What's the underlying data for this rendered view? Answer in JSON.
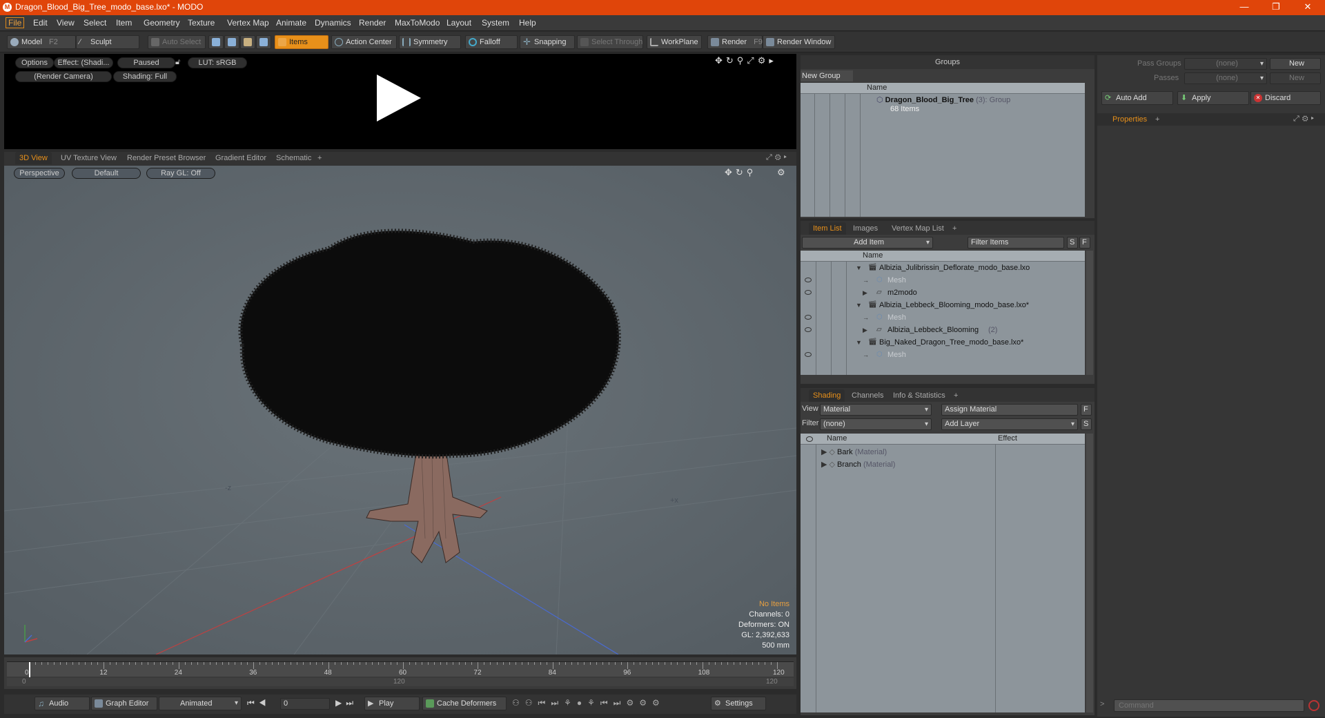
{
  "window": {
    "title": "Dragon_Blood_Big_Tree_modo_base.lxo* - MODO",
    "minimize": "—",
    "restore": "❐",
    "close": "✕"
  },
  "menu": [
    "File",
    "Edit",
    "View",
    "Select",
    "Item",
    "Geometry",
    "Texture",
    "Vertex Map",
    "Animate",
    "Dynamics",
    "Render",
    "MaxToModo",
    "Layout",
    "System",
    "Help"
  ],
  "toolbar": {
    "model": "Model",
    "model_key": "F2",
    "sculpt": "Sculpt",
    "auto_select": "Auto Select",
    "items": "Items",
    "action_center": "Action Center",
    "symmetry": "Symmetry",
    "falloff": "Falloff",
    "snapping": "Snapping",
    "select_through": "Select Through",
    "workplane": "WorkPlane",
    "render": "Render",
    "render_key": "F9",
    "render_window": "Render Window"
  },
  "preview": {
    "options": "Options",
    "effect": "Effect: (Shadi...",
    "paused": "Paused",
    "lut": "LUT: sRGB",
    "camera": "(Render Camera)",
    "shading": "Shading: Full"
  },
  "viewport": {
    "tabs": [
      "3D View",
      "UV Texture View",
      "Render Preset Browser",
      "Gradient Editor",
      "Schematic"
    ],
    "add_tab": "+",
    "perspective": "Perspective",
    "default": "Default",
    "raygl": "Ray GL: Off",
    "stats": {
      "items": "No Items",
      "channels": "Channels: 0",
      "deformers": "Deformers: ON",
      "gl": "GL: 2,392,633",
      "scale": "500 mm"
    }
  },
  "timeline": {
    "ticks": [
      "0",
      "12",
      "24",
      "36",
      "48",
      "60",
      "72",
      "84",
      "96",
      "108",
      "120"
    ],
    "sub_left": "0",
    "sub_mid": "120",
    "sub_right": "120"
  },
  "bottombar": {
    "audio": "Audio",
    "graph_editor": "Graph Editor",
    "animated": "Animated",
    "frame": "0",
    "play": "Play",
    "cache_deformers": "Cache Deformers",
    "settings": "Settings"
  },
  "groups": {
    "title": "Groups",
    "new_group": "New Group",
    "col_name": "Name",
    "item_name": "Dragon_Blood_Big_Tree",
    "item_count": "(3)",
    "item_type": ": Group",
    "item_sub": "68 Items"
  },
  "itemlist": {
    "tabs": [
      "Item List",
      "Images",
      "Vertex Map List"
    ],
    "add_tab": "+",
    "add_item": "Add Item",
    "filter": "Filter Items",
    "btn_s": "S",
    "btn_f": "F",
    "col_name": "Name",
    "rows": [
      {
        "label": "Albizia_Julibrissin_Deflorate_modo_base.lxo",
        "extra": "",
        "level": 0,
        "dim": false
      },
      {
        "label": "Mesh",
        "extra": "",
        "level": 1,
        "dim": true
      },
      {
        "label": "m2modo",
        "extra": "",
        "level": 1,
        "dim": false
      },
      {
        "label": "Albizia_Lebbeck_Blooming_modo_base.lxo*",
        "extra": "",
        "level": 0,
        "dim": false
      },
      {
        "label": "Mesh",
        "extra": "",
        "level": 1,
        "dim": true
      },
      {
        "label": "Albizia_Lebbeck_Blooming",
        "extra": "(2)",
        "level": 1,
        "dim": false
      },
      {
        "label": "Big_Naked_Dragon_Tree_modo_base.lxo*",
        "extra": "",
        "level": 0,
        "dim": false
      },
      {
        "label": "Mesh",
        "extra": "",
        "level": 1,
        "dim": true
      }
    ]
  },
  "shading": {
    "tabs": [
      "Shading",
      "Channels",
      "Info & Statistics"
    ],
    "add_tab": "+",
    "view_label": "View",
    "view_value": "Material",
    "assign_material": "Assign Material",
    "filter_label": "Filter",
    "filter_value": "(none)",
    "add_layer": "Add Layer",
    "btn_f": "F",
    "btn_s": "S",
    "col_name": "Name",
    "col_effect": "Effect",
    "rows": [
      {
        "name": "Bark",
        "type": "(Material)"
      },
      {
        "name": "Branch",
        "type": "(Material)"
      }
    ]
  },
  "right": {
    "pass_groups": "Pass Groups",
    "pass_groups_value": "(none)",
    "passes": "Passes",
    "passes_value": "(none)",
    "new1": "New",
    "new2": "New",
    "auto_add": "Auto Add",
    "apply": "Apply",
    "discard": "Discard",
    "properties_tab": "Properties",
    "add_tab": "+",
    "command_placeholder": "Command"
  },
  "colors": {
    "accent": "#e8901a",
    "titlebar": "#e0450a",
    "viewport_bg": "#5f686f",
    "list_bg": "#8d959b"
  }
}
